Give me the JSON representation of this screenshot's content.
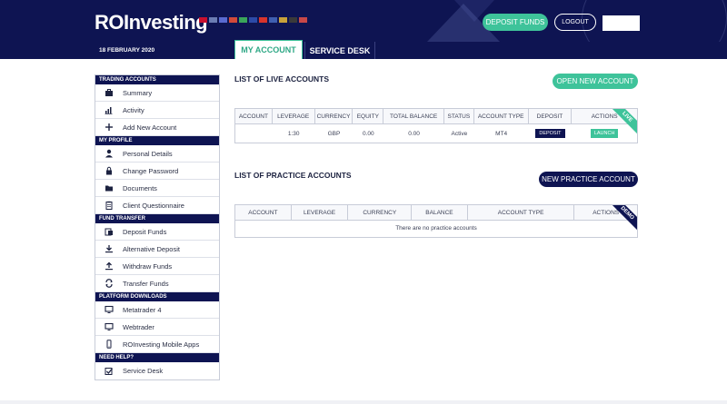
{
  "header": {
    "logo": "ROInvesting",
    "deposit_label": "DEPOSIT FUNDS",
    "logout_label": "LOGOUT",
    "flag_colors": [
      "#c8102e",
      "#6b7db3",
      "#5a6bd0",
      "#d24a3a",
      "#3aa65a",
      "#2c4aa8",
      "#d8342c",
      "#3f5fb0",
      "#c8a23a",
      "#3a3a3a",
      "#c84848"
    ]
  },
  "nav": {
    "date": "18 FEBRUARY 2020",
    "tab_account": "MY ACCOUNT",
    "tab_service": "SERVICE DESK"
  },
  "sidebar": {
    "sections": [
      {
        "title": "TRADING ACCOUNTS",
        "items": [
          {
            "label": "Summary",
            "icon": "briefcase-icon"
          },
          {
            "label": "Activity",
            "icon": "bar-chart-icon"
          },
          {
            "label": "Add New Account",
            "icon": "plus-icon"
          }
        ]
      },
      {
        "title": "MY PROFILE",
        "items": [
          {
            "label": "Personal Details",
            "icon": "user-icon"
          },
          {
            "label": "Change Password",
            "icon": "lock-icon"
          },
          {
            "label": "Documents",
            "icon": "folder-icon"
          },
          {
            "label": "Client Questionnaire",
            "icon": "clipboard-icon"
          }
        ]
      },
      {
        "title": "FUND TRANSFER",
        "items": [
          {
            "label": "Deposit Funds",
            "icon": "deposit-icon"
          },
          {
            "label": "Alternative Deposit",
            "icon": "download-icon"
          },
          {
            "label": "Withdraw Funds",
            "icon": "upload-icon"
          },
          {
            "label": "Transfer Funds",
            "icon": "transfer-icon"
          }
        ]
      },
      {
        "title": "PLATFORM DOWNLOADS",
        "items": [
          {
            "label": "Metatrader 4",
            "icon": "monitor-icon"
          },
          {
            "label": "Webtrader",
            "icon": "monitor-icon"
          },
          {
            "label": "ROInvesting Mobile Apps",
            "icon": "mobile-icon"
          }
        ]
      },
      {
        "title": "NEED HELP?",
        "items": [
          {
            "label": "Service Desk",
            "icon": "checkbox-icon"
          }
        ]
      }
    ]
  },
  "live": {
    "title": "LIST OF LIVE ACCOUNTS",
    "open_label": "OPEN NEW ACCOUNT",
    "ribbon": "LIVE",
    "columns": [
      "ACCOUNT",
      "LEVERAGE",
      "CURRENCY",
      "EQUITY",
      "TOTAL BALANCE",
      "STATUS",
      "ACCOUNT TYPE",
      "DEPOSIT",
      "ACTIONS"
    ],
    "row": {
      "account": "",
      "leverage": "1:30",
      "currency": "GBP",
      "equity": "0.00",
      "balance": "0.00",
      "status": "Active",
      "type": "MT4",
      "deposit": "DEPOSIT",
      "launch": "LAUNCH"
    }
  },
  "practice": {
    "title": "LIST OF PRACTICE ACCOUNTS",
    "new_label": "NEW PRACTICE ACCOUNT",
    "ribbon": "DEMO",
    "columns": [
      "ACCOUNT",
      "LEVERAGE",
      "CURRENCY",
      "BALANCE",
      "ACCOUNT TYPE",
      "ACTIONS"
    ],
    "empty": "There are no practice accounts"
  }
}
